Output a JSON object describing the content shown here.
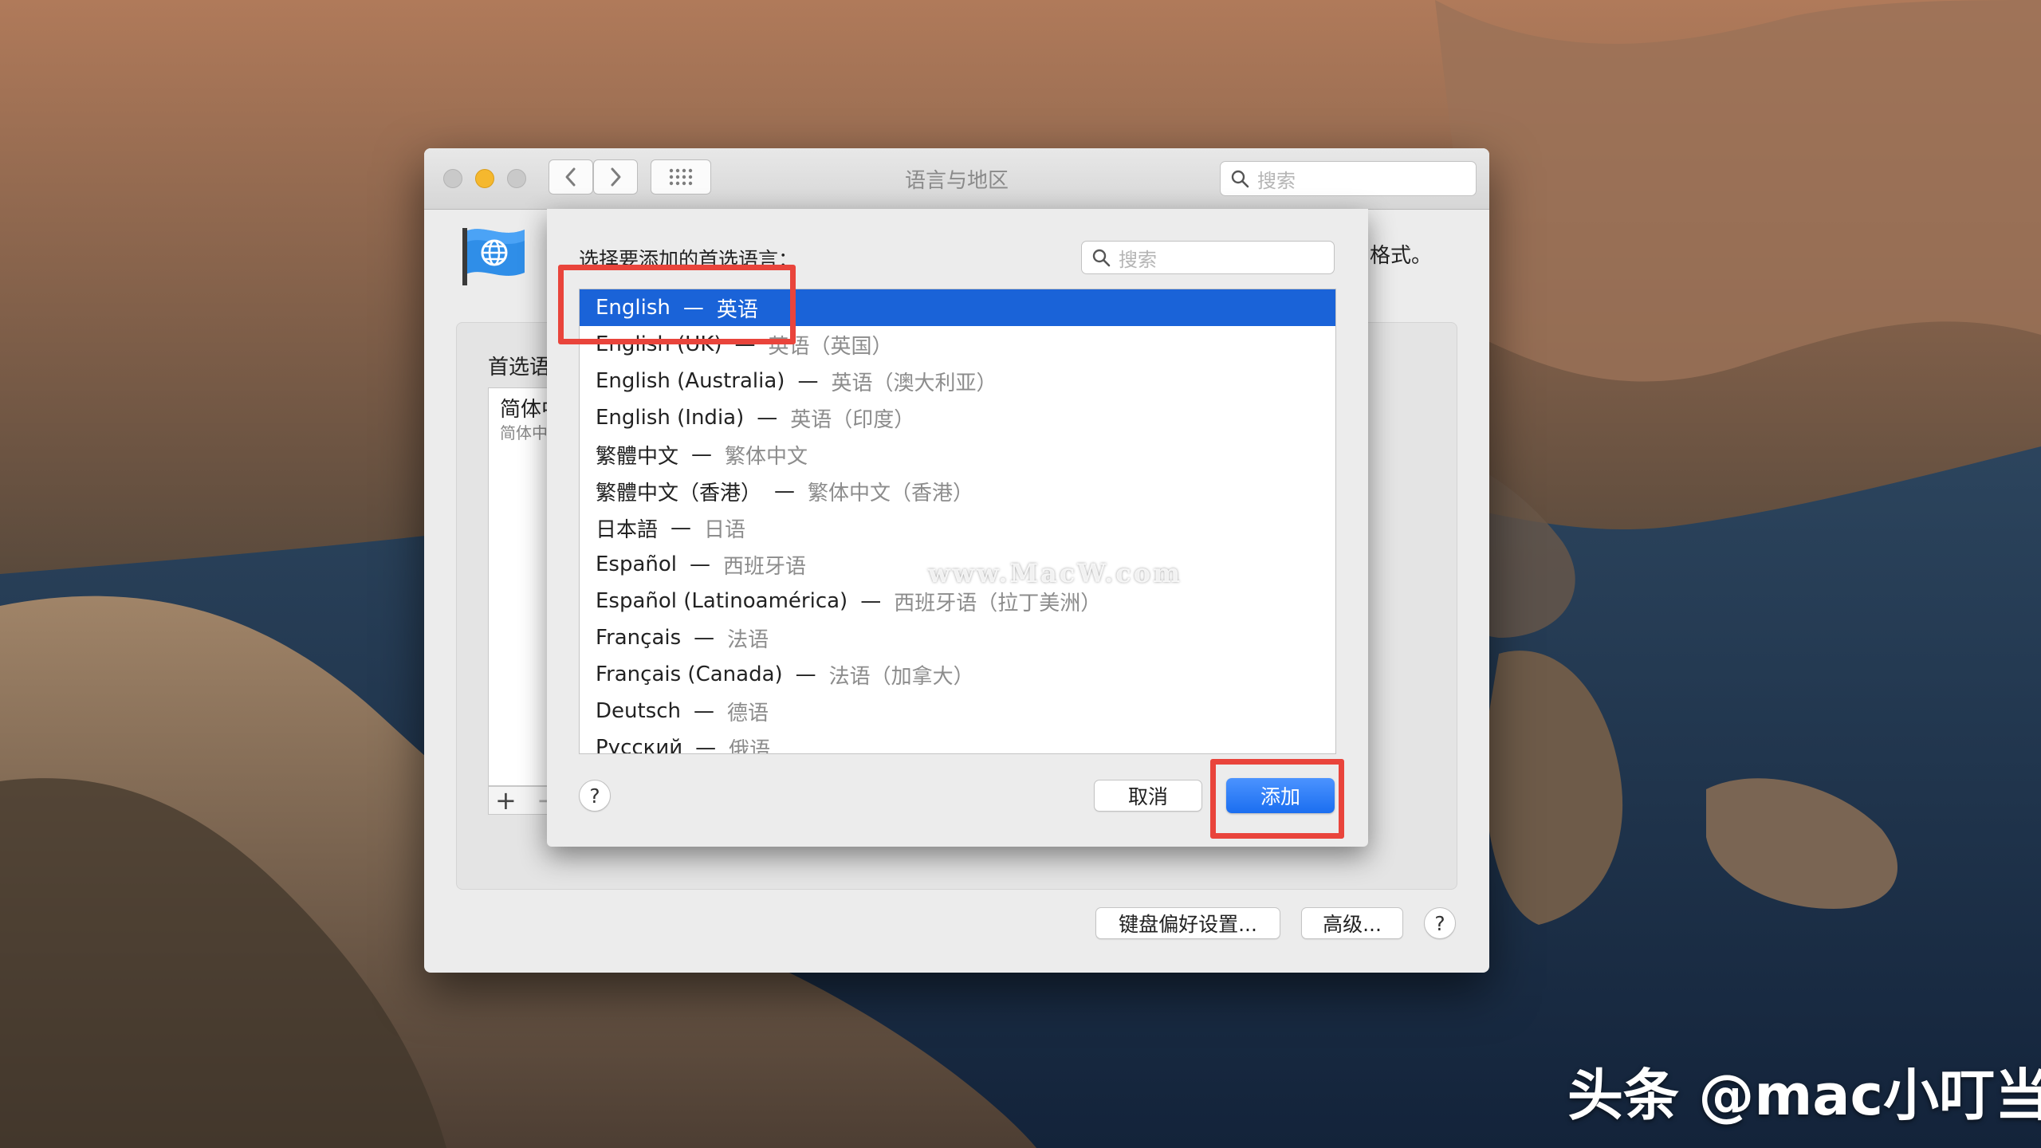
{
  "window": {
    "title": "语言与地区",
    "search_placeholder": "搜索",
    "formats_text": "格式。",
    "preferred_label": "首选语",
    "preferred_item_name": "简体中",
    "preferred_item_sub": "简体中",
    "add_symbol": "+",
    "remove_symbol": "−",
    "keyboard_button": "键盘偏好设置...",
    "advanced_button": "高级...",
    "help_symbol": "?"
  },
  "dialog": {
    "prompt": "选择要添加的首选语言：",
    "search_placeholder": "搜索",
    "cancel_button": "取消",
    "add_button": "添加",
    "help_symbol": "?",
    "separator": "—",
    "languages": [
      {
        "native": "English",
        "localized": "英语",
        "selected": true
      },
      {
        "native": "English (UK)",
        "localized": "英语（英国）"
      },
      {
        "native": "English (Australia)",
        "localized": "英语（澳大利亚）"
      },
      {
        "native": "English (India)",
        "localized": "英语（印度）"
      },
      {
        "native": "繁體中文",
        "localized": "繁体中文"
      },
      {
        "native": "繁體中文（香港）",
        "localized": "繁体中文（香港）"
      },
      {
        "native": "日本語",
        "localized": "日语"
      },
      {
        "native": "Español",
        "localized": "西班牙语"
      },
      {
        "native": "Español (Latinoamérica)",
        "localized": "西班牙语（拉丁美洲）"
      },
      {
        "native": "Français",
        "localized": "法语"
      },
      {
        "native": "Français (Canada)",
        "localized": "法语（加拿大）"
      },
      {
        "native": "Deutsch",
        "localized": "德语"
      },
      {
        "native": "Русский",
        "localized": "俄语"
      }
    ]
  },
  "overlay": {
    "watermark": "www.MacW.com",
    "credit": "头条 @mac小叮当"
  },
  "colors": {
    "selection": "#1a63d8",
    "highlight": "#e9443b",
    "close_light": "#c9c9c9",
    "minimize_light": "#f5b82e",
    "zoom_light": "#c9c9c9",
    "add_button": "#1b6ef0"
  }
}
